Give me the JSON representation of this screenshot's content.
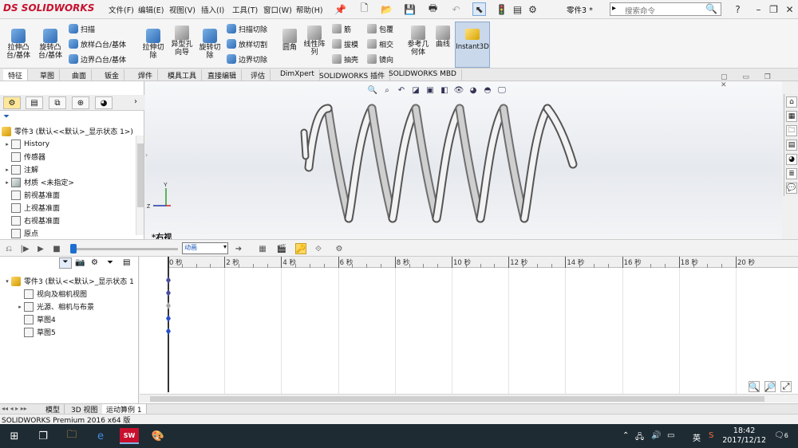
{
  "title_bar": {
    "logo": "SOLIDWORKS",
    "logo_prefix": "DS",
    "menu": [
      "文件(F)",
      "编辑(E)",
      "视图(V)",
      "插入(I)",
      "工具(T)",
      "窗口(W)",
      "帮助(H)"
    ],
    "document_title": "零件3 *",
    "search_placeholder": "搜索命令"
  },
  "ribbon": {
    "extrude_boss": "拉伸凸\n台/基体",
    "revolve_boss": "旋转凸\n台/基体",
    "sweep": "扫描",
    "loft_boss": "放样凸台/基体",
    "boundary_boss": "边界凸台/基体",
    "extrude_cut": "拉伸切\n除",
    "hole_wizard": "异型孔\n向导",
    "revolve_cut": "旋转切\n除",
    "sweep_cut": "扫描切除",
    "loft_cut": "放样切割",
    "boundary_cut": "边界切除",
    "fillet": "圆角",
    "linear_pattern": "线性阵\n列",
    "rib": "筋",
    "draft": "拔模",
    "shell": "抽壳",
    "wrap": "包覆",
    "intersect": "相交",
    "mirror": "镜向",
    "reference_geometry": "参考几\n何体",
    "curves": "曲线",
    "instant3d": "Instant3D"
  },
  "command_tabs": [
    "特征",
    "草图",
    "曲面",
    "钣金",
    "焊件",
    "模具工具",
    "直接编辑",
    "评估",
    "DimXpert",
    "SOLIDWORKS 插件",
    "SOLIDWORKS MBD"
  ],
  "feature_tree": {
    "root": "零件3 (默认<<默认>_显示状态 1>)",
    "items": [
      {
        "label": "History",
        "expandable": true
      },
      {
        "label": "传感器",
        "expandable": false
      },
      {
        "label": "注解",
        "expandable": true
      },
      {
        "label": "材质 <未指定>",
        "expandable": true
      },
      {
        "label": "前视基准面",
        "expandable": false
      },
      {
        "label": "上视基准面",
        "expandable": false
      },
      {
        "label": "右视基准面",
        "expandable": false
      },
      {
        "label": "原点",
        "expandable": false
      }
    ]
  },
  "viewport": {
    "view_label": "*右视",
    "axis_y": "Y",
    "axis_z": "Z"
  },
  "motion_toolbar": {
    "study_type": "动画"
  },
  "motion_tree": {
    "root": "零件3 (默认<<默认>_显示状态 1",
    "items": [
      {
        "label": "视向及相机视图",
        "expandable": false
      },
      {
        "label": "光源、相机与布景",
        "expandable": true
      },
      {
        "label": "草图4",
        "expandable": false
      },
      {
        "label": "草图5",
        "expandable": false
      }
    ]
  },
  "timeline": {
    "ticks": [
      "0 秒",
      "2 秒",
      "4 秒",
      "6 秒",
      "8 秒",
      "10 秒",
      "12 秒",
      "14 秒",
      "16 秒",
      "18 秒",
      "20 秒"
    ]
  },
  "bottom_tabs": [
    "模型",
    "3D 视图",
    "运动算例 1"
  ],
  "status_bar": {
    "text": "SOLIDWORKS Premium 2016 x64 版"
  },
  "taskbar": {
    "ime": "英",
    "time": "18:42",
    "date": "2017/12/12",
    "notifications": "6"
  }
}
